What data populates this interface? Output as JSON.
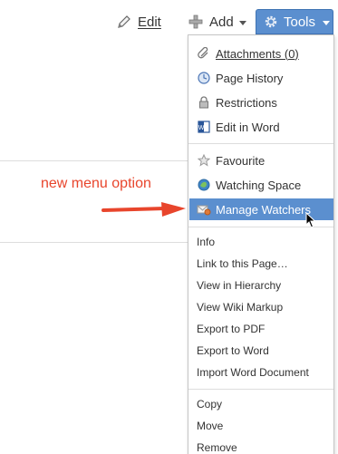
{
  "toolbar": {
    "edit_label": "Edit",
    "add_label": "Add",
    "tools_label": "Tools"
  },
  "menu": {
    "group1": [
      {
        "label": "Attachments (0)",
        "icon": "paperclip-icon"
      },
      {
        "label": "Page History",
        "icon": "clock-icon"
      },
      {
        "label": "Restrictions",
        "icon": "lock-icon"
      },
      {
        "label": "Edit in Word",
        "icon": "word-icon"
      }
    ],
    "group2": [
      {
        "label": "Favourite",
        "icon": "star-icon"
      },
      {
        "label": "Watching Space",
        "icon": "eye-icon"
      },
      {
        "label": "Manage Watchers",
        "icon": "watchers-icon",
        "highlighted": true
      }
    ],
    "group3": [
      {
        "label": "Info"
      },
      {
        "label": "Link to this Page…"
      },
      {
        "label": "View in Hierarchy"
      },
      {
        "label": "View Wiki Markup"
      },
      {
        "label": "Export to PDF"
      },
      {
        "label": "Export to Word"
      },
      {
        "label": "Import Word Document"
      }
    ],
    "group4": [
      {
        "label": "Copy"
      },
      {
        "label": "Move"
      },
      {
        "label": "Remove"
      }
    ]
  },
  "annotation": {
    "text": "new menu option",
    "color": "#e8452c"
  },
  "colors": {
    "highlight": "#5b8fcf",
    "accent_annotation": "#e8452c"
  }
}
